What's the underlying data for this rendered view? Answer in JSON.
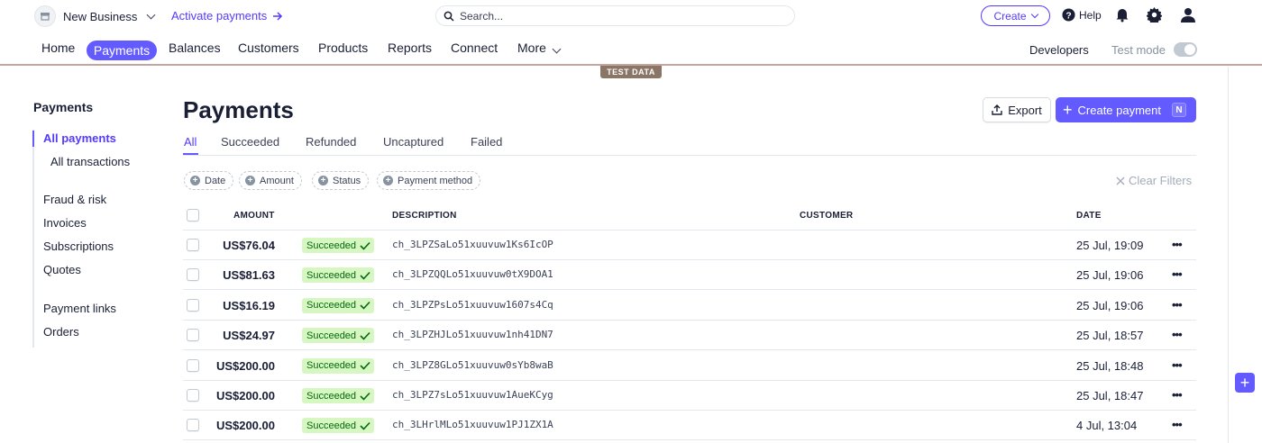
{
  "topbar": {
    "business_name": "New Business",
    "activate_label": "Activate payments",
    "search_placeholder": "Search...",
    "create_label": "Create",
    "help_label": "Help"
  },
  "nav": {
    "items": [
      "Home",
      "Payments",
      "Balances",
      "Customers",
      "Products",
      "Reports",
      "Connect",
      "More"
    ],
    "active": "Payments",
    "developers_label": "Developers",
    "test_mode_label": "Test mode",
    "test_mode_on": false,
    "test_data_label": "TEST DATA"
  },
  "sidebar": {
    "title": "Payments",
    "items": [
      "All payments",
      "All transactions",
      "Fraud & risk",
      "Invoices",
      "Subscriptions",
      "Quotes",
      "Payment links",
      "Orders"
    ],
    "active": "All payments"
  },
  "main": {
    "title": "Payments",
    "export_label": "Export",
    "create_payment_label": "Create payment",
    "create_payment_shortcut": "N",
    "tabs": [
      "All",
      "Succeeded",
      "Refunded",
      "Uncaptured",
      "Failed"
    ],
    "active_tab": "All",
    "filters": [
      "Date",
      "Amount",
      "Status",
      "Payment method"
    ],
    "clear_filters_label": "Clear Filters"
  },
  "table": {
    "columns": [
      "AMOUNT",
      "DESCRIPTION",
      "CUSTOMER",
      "DATE"
    ],
    "rows": [
      {
        "amount": "US$76.04",
        "status": "Succeeded",
        "description": "ch_3LPZSaLo51xuuvuw1Ks6IcOP",
        "customer": "",
        "date": "25 Jul, 19:09"
      },
      {
        "amount": "US$81.63",
        "status": "Succeeded",
        "description": "ch_3LPZQQLo51xuuvuw0tX9DOA1",
        "customer": "",
        "date": "25 Jul, 19:06"
      },
      {
        "amount": "US$16.19",
        "status": "Succeeded",
        "description": "ch_3LPZPsLo51xuuvuw1607s4Cq",
        "customer": "",
        "date": "25 Jul, 19:06"
      },
      {
        "amount": "US$24.97",
        "status": "Succeeded",
        "description": "ch_3LPZHJLo51xuuvuw1nh41DN7",
        "customer": "",
        "date": "25 Jul, 18:57"
      },
      {
        "amount": "US$200.00",
        "status": "Succeeded",
        "description": "ch_3LPZ8GLo51xuuvuw0sYb8waB",
        "customer": "",
        "date": "25 Jul, 18:48"
      },
      {
        "amount": "US$200.00",
        "status": "Succeeded",
        "description": "ch_3LPZ7sLo51xuuvuw1AueKCyg",
        "customer": "",
        "date": "25 Jul, 18:47"
      },
      {
        "amount": "US$200.00",
        "status": "Succeeded",
        "description": "ch_3LHrlMLo51xuuvuw1PJ1ZX1A",
        "customer": "",
        "date": "4 Jul, 13:04"
      }
    ]
  },
  "colors": {
    "accent": "#635bff",
    "success_bg": "#d7f7c2",
    "success_text": "#05690d"
  }
}
